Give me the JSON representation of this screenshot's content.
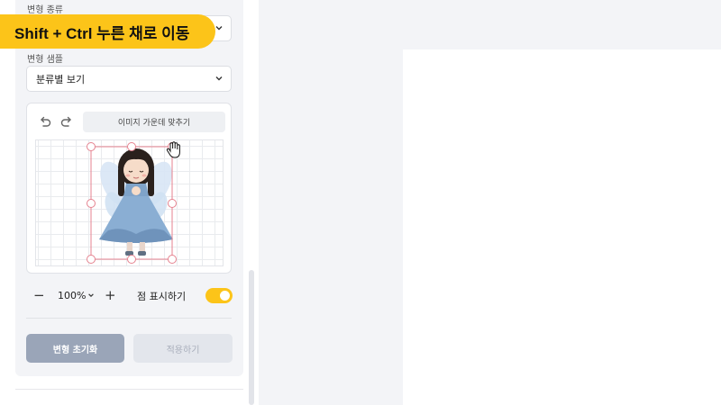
{
  "tooltip": {
    "text": "Shift + Ctrl 누른 채로 이동"
  },
  "panel": {
    "transform_type_label": "변형 종류",
    "transform_sample_label": "변형 샘플",
    "transform_sample_value": "분류별 보기"
  },
  "editor": {
    "undo_icon": "undo-icon",
    "redo_icon": "redo-icon",
    "center_button_label": "이미지 가운데 맞추기"
  },
  "zoom": {
    "minus": "−",
    "value": "100%",
    "plus": "+"
  },
  "dots": {
    "label": "점 표시하기",
    "enabled": true
  },
  "actions": {
    "reset_label": "변형 초기화",
    "apply_label": "적용하기"
  },
  "colors": {
    "accent": "#fcc419",
    "handle": "#e5828f",
    "reset_button": "#9aa5b8",
    "apply_button": "#e3e6ec",
    "workspace": "#f3f4f7"
  }
}
